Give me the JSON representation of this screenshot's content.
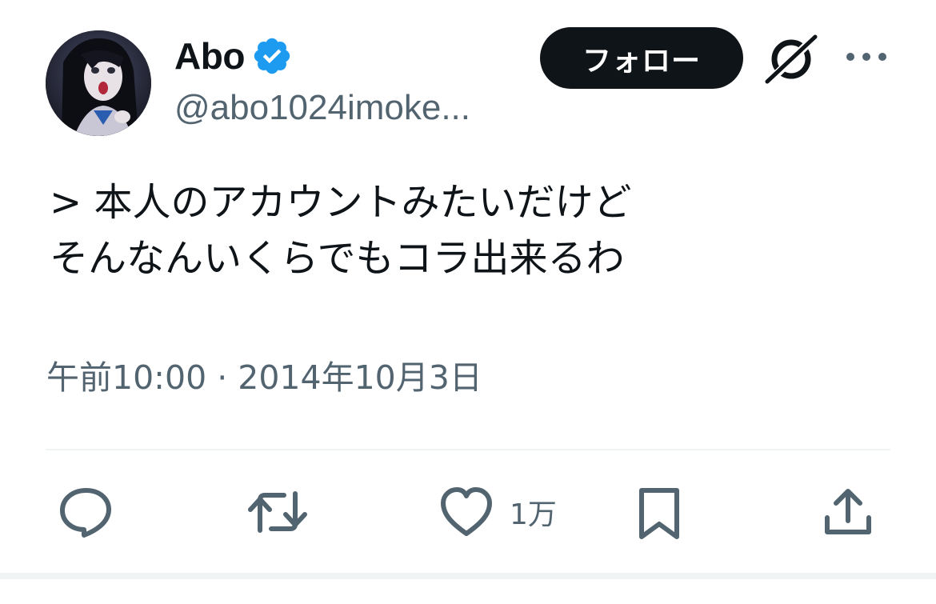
{
  "author": {
    "display_name": "Abo",
    "handle": "@abo1024imoke...",
    "verified": true
  },
  "follow_button": {
    "label": "フォロー"
  },
  "tweet": {
    "lines": [
      "> 本人のアカウントみたいだけど",
      "そんなんいくらでもコラ出来るわ"
    ],
    "timestamp": "午前10:00 · 2014年10月3日"
  },
  "actions": {
    "like_count": "1万"
  },
  "icons": {
    "avatar": "avatar",
    "verified": "verified-badge-icon",
    "grok": "grok-icon",
    "more": "more-icon",
    "reply": "reply-icon",
    "retweet": "retweet-icon",
    "like": "heart-icon",
    "bookmark": "bookmark-icon",
    "share": "share-icon"
  },
  "colors": {
    "text_primary": "#0f1419",
    "text_secondary": "#536471",
    "verified_blue": "#1d9bf0",
    "follow_bg": "#0f1419",
    "divider": "#eff3f4"
  }
}
